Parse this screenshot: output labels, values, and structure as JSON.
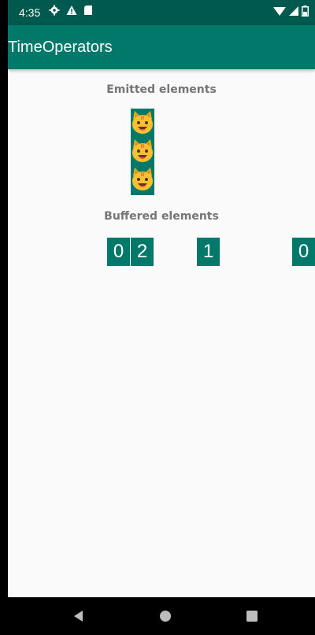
{
  "status_bar": {
    "time": "4:35",
    "icons_left": [
      "gear-icon",
      "warning-icon",
      "sd-card-icon"
    ],
    "icons_right": [
      "wifi-icon",
      "signal-icon",
      "battery-icon"
    ]
  },
  "app_bar": {
    "title": "TimeOperators",
    "color": "#00796b"
  },
  "emitted": {
    "label": "Emitted elements",
    "items": [
      "cat-face-icon",
      "cat-face-icon",
      "cat-face-icon"
    ]
  },
  "buffered": {
    "label": "Buffered elements",
    "boxes": [
      {
        "value": "0"
      },
      {
        "value": "2"
      },
      {
        "value": "1"
      },
      {
        "value": "0"
      }
    ]
  },
  "nav_bar": {
    "buttons": [
      "back-icon",
      "home-icon",
      "recents-icon"
    ]
  }
}
